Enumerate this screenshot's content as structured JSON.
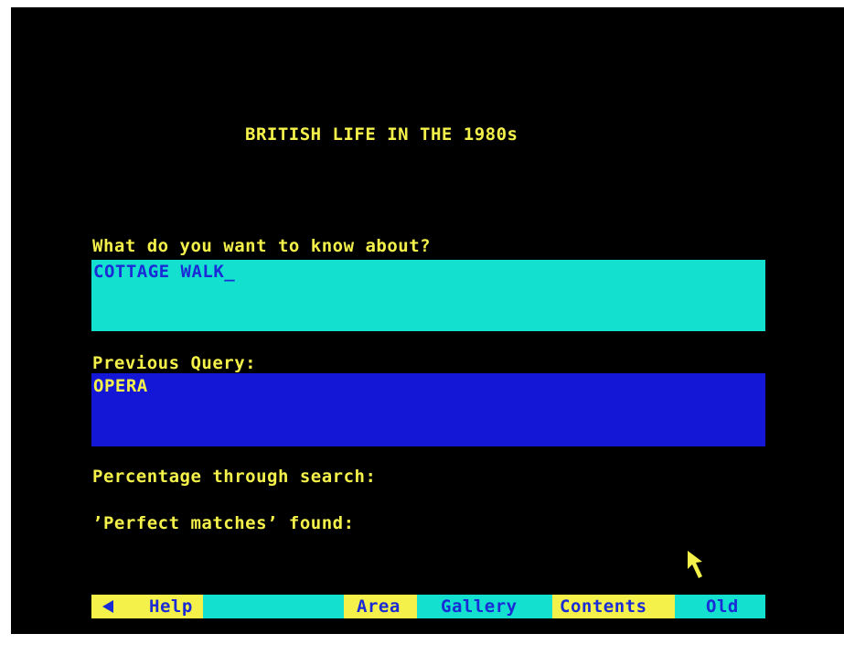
{
  "title": "BRITISH LIFE IN THE 1980s",
  "query": {
    "label": "What do you want to know about?",
    "value": "COTTAGE WALK",
    "cursor": "_"
  },
  "previous": {
    "label": "Previous Query:",
    "value": "OPERA"
  },
  "status": {
    "percentage_label": "Percentage through search:",
    "matches_label": "’Perfect matches’ found:"
  },
  "pointer_icon": "arrow-pointer-icon",
  "menubar": {
    "back_icon": "left-arrow-icon",
    "help": "Help",
    "area": "Area",
    "gallery": "Gallery",
    "contents": "Contents",
    "old": "Old"
  },
  "colors": {
    "background": "#000000",
    "text_yellow": "#f4f14a",
    "cyan": "#14e0d0",
    "blue": "#1418d6"
  }
}
